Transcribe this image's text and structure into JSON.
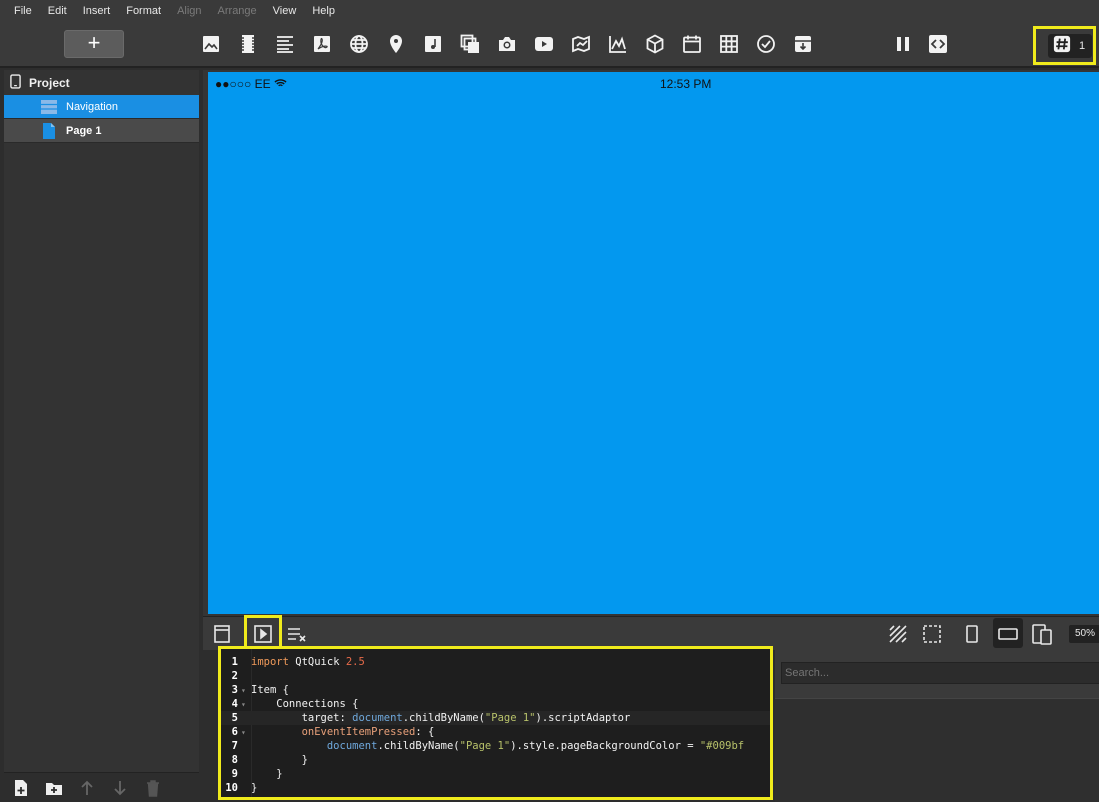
{
  "menu": {
    "items": [
      {
        "label": "File",
        "enabled": true
      },
      {
        "label": "Edit",
        "enabled": true
      },
      {
        "label": "Insert",
        "enabled": true
      },
      {
        "label": "Format",
        "enabled": true
      },
      {
        "label": "Align",
        "enabled": false
      },
      {
        "label": "Arrange",
        "enabled": false
      },
      {
        "label": "View",
        "enabled": true
      },
      {
        "label": "Help",
        "enabled": true
      }
    ]
  },
  "toolbar": {
    "add_label": "+",
    "hash_count": "1",
    "icons": [
      "image-icon",
      "film-icon",
      "text-icon",
      "pdf-icon",
      "globe-icon",
      "map-pin-icon",
      "music-icon",
      "gallery-icon",
      "camera-icon",
      "video-icon",
      "map-icon",
      "chart-icon",
      "cube-icon",
      "calendar-icon",
      "grid-icon",
      "check-icon",
      "archive-icon",
      "pause-icon",
      "code-icon",
      "hash-icon"
    ]
  },
  "sidebar": {
    "project_label": "Project",
    "items": [
      {
        "label": "Navigation",
        "selected": true
      },
      {
        "label": "Page 1",
        "selected": false
      }
    ]
  },
  "device": {
    "carrier": "●●○○○ EE",
    "time": "12:53 PM",
    "background": "#0398ef"
  },
  "editor": {
    "lines": [
      {
        "n": "1",
        "fold": "",
        "code": [
          {
            "t": "import ",
            "c": "kw"
          },
          {
            "t": "QtQuick ",
            "c": ""
          },
          {
            "t": "2.5",
            "c": "num"
          }
        ]
      },
      {
        "n": "2",
        "fold": "",
        "code": []
      },
      {
        "n": "3",
        "fold": "▾",
        "code": [
          {
            "t": "Item {",
            "c": ""
          }
        ]
      },
      {
        "n": "4",
        "fold": "▾",
        "code": [
          {
            "t": "    Connections {",
            "c": ""
          }
        ]
      },
      {
        "n": "5",
        "fold": "",
        "code": [
          {
            "t": "        target: ",
            "c": ""
          },
          {
            "t": "document",
            "c": "obj"
          },
          {
            "t": ".childByName(",
            "c": ""
          },
          {
            "t": "\"Page 1\"",
            "c": "str"
          },
          {
            "t": ").scriptAdaptor",
            "c": ""
          }
        ]
      },
      {
        "n": "6",
        "fold": "▾",
        "code": [
          {
            "t": "        ",
            "c": ""
          },
          {
            "t": "onEventItemPressed",
            "c": "prop"
          },
          {
            "t": ": {",
            "c": ""
          }
        ]
      },
      {
        "n": "7",
        "fold": "",
        "code": [
          {
            "t": "            ",
            "c": ""
          },
          {
            "t": "document",
            "c": "obj"
          },
          {
            "t": ".childByName(",
            "c": ""
          },
          {
            "t": "\"Page 1\"",
            "c": "str"
          },
          {
            "t": ").style.pageBackgroundColor = ",
            "c": ""
          },
          {
            "t": "\"#009bf",
            "c": "str"
          }
        ]
      },
      {
        "n": "8",
        "fold": "",
        "code": [
          {
            "t": "        }",
            "c": ""
          }
        ]
      },
      {
        "n": "9",
        "fold": "",
        "code": [
          {
            "t": "    }",
            "c": ""
          }
        ]
      },
      {
        "n": "10",
        "fold": "",
        "code": [
          {
            "t": "}",
            "c": ""
          }
        ]
      }
    ]
  },
  "right_panel": {
    "search_placeholder": "Search..."
  },
  "bottom": {
    "zoom": "50%"
  }
}
